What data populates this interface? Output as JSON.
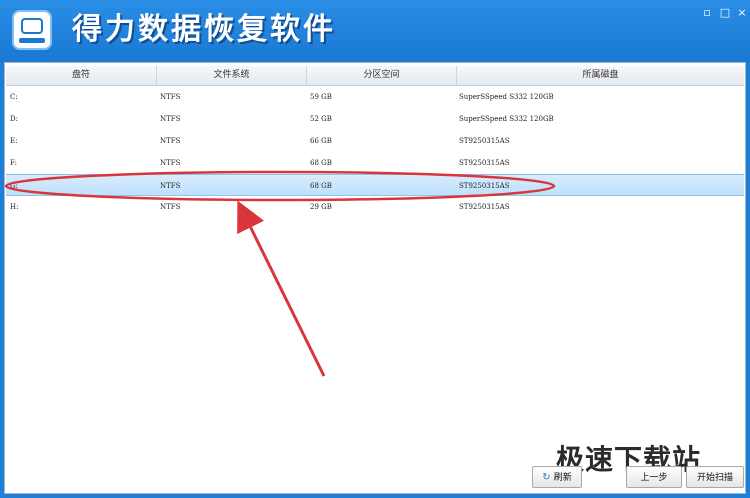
{
  "window": {
    "title": "得力数据恢复软件",
    "minimize_glyph": "▫",
    "maximize_glyph": "□",
    "close_glyph": "×"
  },
  "table": {
    "columns": [
      "盘符",
      "文件系统",
      "分区空间",
      "所属磁盘"
    ],
    "rows": [
      {
        "drive": "C:",
        "fs": "NTFS",
        "size": "59 GB",
        "disk": "SuperSSpeed S332 120GB"
      },
      {
        "drive": "D:",
        "fs": "NTFS",
        "size": "52 GB",
        "disk": "SuperSSpeed S332 120GB"
      },
      {
        "drive": "E:",
        "fs": "NTFS",
        "size": "66 GB",
        "disk": "ST9250315AS"
      },
      {
        "drive": "F:",
        "fs": "NTFS",
        "size": "68 GB",
        "disk": "ST9250315AS"
      },
      {
        "drive": "G:",
        "fs": "NTFS",
        "size": "68 GB",
        "disk": "ST9250315AS"
      },
      {
        "drive": "H:",
        "fs": "NTFS",
        "size": "29 GB",
        "disk": "ST9250315AS"
      }
    ],
    "selected_index": 4
  },
  "buttons": {
    "refresh_label": "刷新",
    "prev_label": "上一步",
    "start_scan_label": "开始扫描"
  },
  "icons": {
    "refresh": "refresh-icon"
  },
  "watermark": "极速下载站",
  "colors": {
    "titlebar": "#1a78d2",
    "annotation": "#d9363b",
    "selected_row": "#bfe0fb"
  }
}
